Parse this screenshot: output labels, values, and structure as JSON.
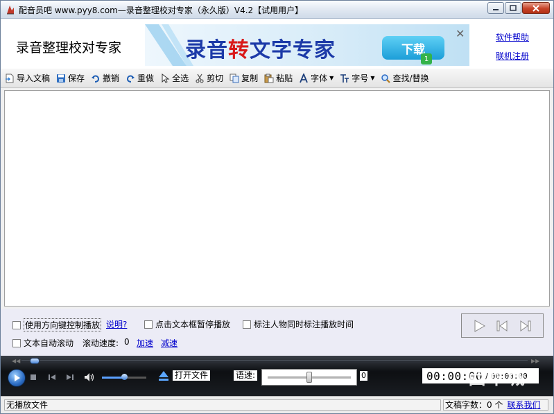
{
  "window": {
    "title": "配音员吧 www.pyy8.com—录音整理校对专家（永久版）V4.2【试用用户】"
  },
  "header": {
    "app_name": "录音整理校对专家",
    "banner": {
      "text_part1": "录音",
      "text_hl": "转",
      "text_part2": "文字专家",
      "download_label": "下载",
      "download_badge": "1"
    },
    "help_link": "软件帮助",
    "register_link": "联机注册"
  },
  "toolbar": {
    "import": "导入文稿",
    "save": "保存",
    "undo": "撤销",
    "redo": "重做",
    "select_all": "全选",
    "cut": "剪切",
    "copy": "复制",
    "paste": "粘贴",
    "font": "字体",
    "font_size": "字号",
    "find_replace": "查找/替换"
  },
  "options": {
    "arrow_keys_control": "使用方向键控制播放",
    "description_link": "说明?",
    "click_pause": "点击文本框暂停播放",
    "mark_time": "标注人物同时标注播放时间",
    "auto_scroll": "文本自动滚动",
    "scroll_speed_label": "滚动速度:",
    "scroll_speed_value": "0",
    "speed_up": "加速",
    "slow_down": "减速"
  },
  "player": {
    "open_file": "打开文件",
    "speech_rate_label": "语速:",
    "speech_rate_value": "0",
    "current_time": "00:00:00",
    "time_separator": "/",
    "total_time": "00:00:00",
    "seek_progress": 0.02,
    "volume_level": 0.5,
    "rate_position": 0.5
  },
  "status": {
    "file_status": "无播放文件",
    "word_count": "文稿字数：0 个",
    "contact_link": "联系我们"
  },
  "watermark": "西华城"
}
